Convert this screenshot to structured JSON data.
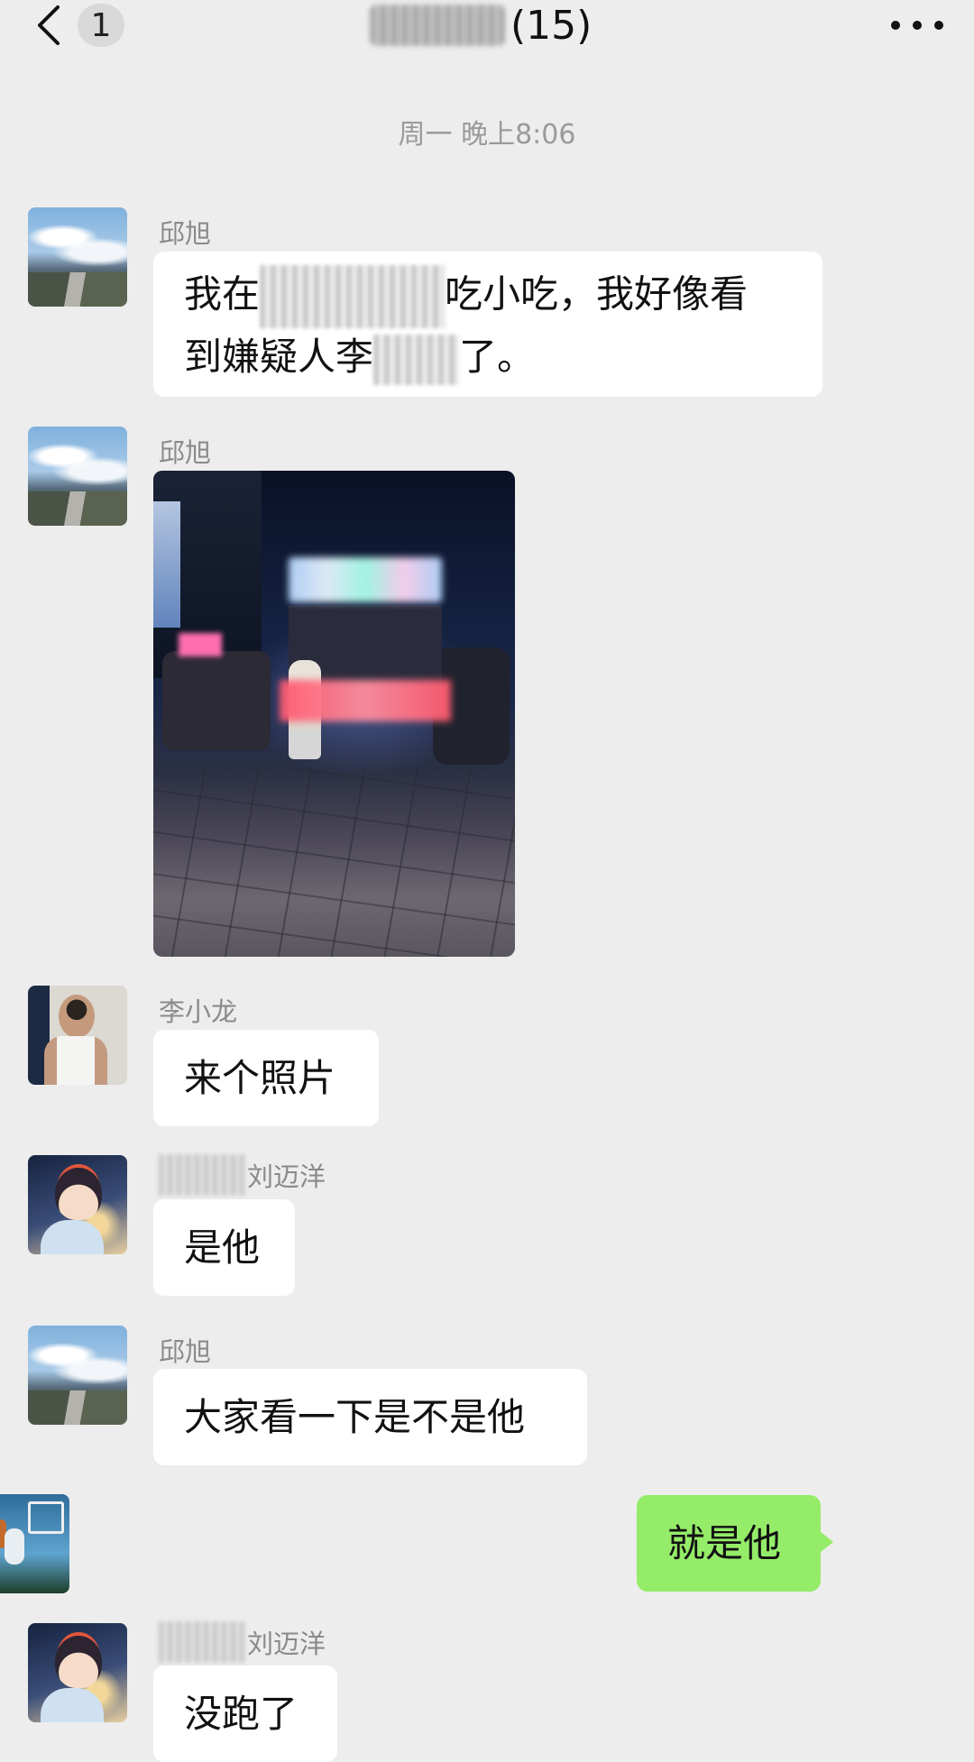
{
  "header": {
    "unread_count": "1",
    "title_count": "(15)"
  },
  "time_separator": "周一 晚上8:06",
  "messages": [
    {
      "sender": "邱旭",
      "text_part1": "我在",
      "text_part2": "吃小吃，我好像看",
      "text_part3": "到嫌疑人李",
      "text_part4": "了。",
      "avatar_icon": "landscape-avatar-icon"
    },
    {
      "sender": "邱旭",
      "type": "image",
      "avatar_icon": "landscape-avatar-icon"
    },
    {
      "sender": "李小龙",
      "text": "来个照片",
      "avatar_icon": "man-portrait-avatar-icon"
    },
    {
      "sender_suffix": "刘迈洋",
      "text": "是他",
      "avatar_icon": "anime-avatar-icon"
    },
    {
      "sender": "邱旭",
      "text": "大家看一下是不是他",
      "avatar_icon": "landscape-avatar-icon"
    },
    {
      "self": true,
      "text": "就是他",
      "avatar_icon": "basketball-avatar-icon"
    },
    {
      "sender_suffix": "刘迈洋",
      "text": "没跑了",
      "avatar_icon": "anime-avatar-icon"
    }
  ],
  "colors": {
    "background": "#ededed",
    "self_bubble": "#95ec69",
    "other_bubble": "#ffffff"
  }
}
